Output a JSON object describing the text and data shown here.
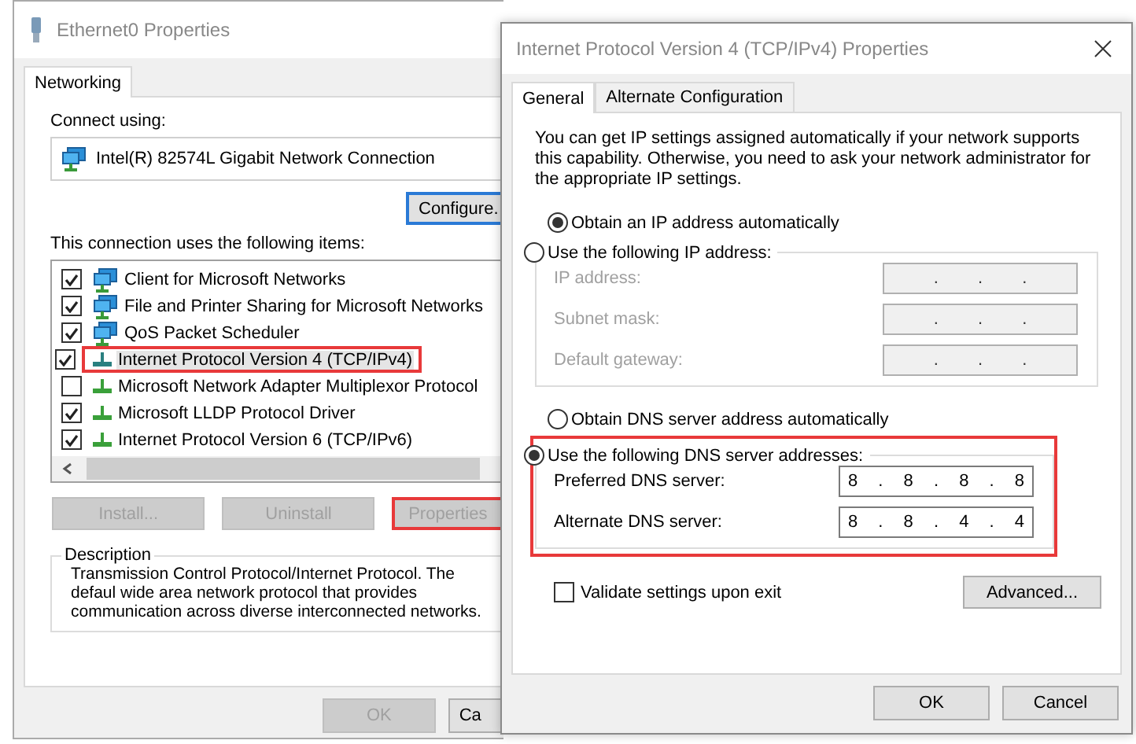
{
  "ethernet_window": {
    "title": "Ethernet0 Properties",
    "tabs": [
      {
        "label": "Networking",
        "selected": true
      }
    ],
    "connect_label": "Connect using:",
    "adapter": "Intel(R) 82574L Gigabit Network Connection",
    "configure_button": "Configure.",
    "items_label": "This connection uses the following items:",
    "items": [
      {
        "label": "Client for Microsoft Networks",
        "kind": "client",
        "checked": true,
        "selected": false,
        "highlighted": false
      },
      {
        "label": "File and Printer Sharing for Microsoft Networks",
        "kind": "service",
        "checked": true,
        "selected": false,
        "highlighted": false
      },
      {
        "label": "QoS Packet Scheduler",
        "kind": "service",
        "checked": true,
        "selected": false,
        "highlighted": false
      },
      {
        "label": "Internet Protocol Version 4 (TCP/IPv4)",
        "kind": "protocol",
        "checked": true,
        "selected": true,
        "highlighted": true
      },
      {
        "label": "Microsoft Network Adapter Multiplexor Protocol",
        "kind": "protocol",
        "checked": false,
        "selected": false,
        "highlighted": false
      },
      {
        "label": "Microsoft LLDP Protocol Driver",
        "kind": "protocol",
        "checked": true,
        "selected": false,
        "highlighted": false
      },
      {
        "label": "Internet Protocol Version 6 (TCP/IPv6)",
        "kind": "protocol",
        "checked": true,
        "selected": false,
        "highlighted": false
      }
    ],
    "buttons": [
      {
        "label": "Install...",
        "disabled": true,
        "highlighted": false
      },
      {
        "label": "Uninstall",
        "disabled": true,
        "highlighted": false
      },
      {
        "label": "Properties",
        "disabled": true,
        "highlighted": true
      }
    ],
    "description": {
      "title": "Description",
      "text": "Transmission Control Protocol/Internet Protocol. The defaul wide area network protocol that provides communication across diverse interconnected networks."
    },
    "footer_buttons": [
      {
        "label": "OK",
        "disabled": true
      },
      {
        "label": "Ca",
        "disabled": false
      }
    ]
  },
  "ipv4_window": {
    "title": "Internet Protocol Version 4 (TCP/IPv4) Properties",
    "tabs": [
      {
        "label": "General",
        "selected": true
      },
      {
        "label": "Alternate Configuration",
        "selected": false
      }
    ],
    "intro": "You can get IP settings assigned automatically if your network supports this capability. Otherwise, you need to ask your network administrator for the appropriate IP settings.",
    "ip_options": [
      {
        "label": "Obtain an IP address automatically",
        "selected": true
      },
      {
        "label": "Use the following IP address:",
        "selected": false
      }
    ],
    "ip_fields": [
      {
        "label": "IP address:",
        "value": ". . .",
        "disabled": true
      },
      {
        "label": "Subnet mask:",
        "value": ". . .",
        "disabled": true
      },
      {
        "label": "Default gateway:",
        "value": ". . .",
        "disabled": true
      }
    ],
    "dns_options": [
      {
        "label": "Obtain DNS server address automatically",
        "selected": false
      },
      {
        "label": "Use the following DNS server addresses:",
        "selected": true
      }
    ],
    "dns_highlighted": true,
    "dns_fields": [
      {
        "label": "Preferred DNS server:",
        "value": "8 . 8 . 8 . 8",
        "disabled": false
      },
      {
        "label": "Alternate DNS server:",
        "value": "8 . 8 . 4 . 4",
        "disabled": false
      }
    ],
    "validate": {
      "label": "Validate settings upon exit",
      "checked": false
    },
    "advanced_button": "Advanced...",
    "footer_buttons": [
      {
        "label": "OK",
        "disabled": false
      },
      {
        "label": "Cancel",
        "disabled": false
      }
    ]
  }
}
